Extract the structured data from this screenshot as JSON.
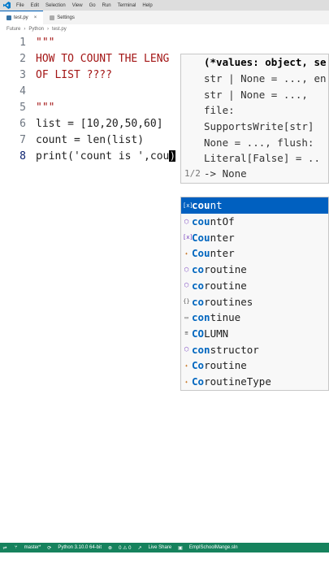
{
  "menubar": {
    "items": [
      "File",
      "Edit",
      "Selection",
      "View",
      "Go",
      "Run",
      "Terminal",
      "Help"
    ]
  },
  "tabs": [
    {
      "label": "test.py",
      "active": true
    },
    {
      "label": "Settings",
      "active": false
    }
  ],
  "breadcrumb": [
    "Future",
    "Python",
    "test.py"
  ],
  "editor": {
    "lines": [
      {
        "number": "1",
        "text": "\"\"\""
      },
      {
        "number": "2",
        "text": "HOW TO COUNT THE LENG"
      },
      {
        "number": "3",
        "text": "OF LIST ????"
      },
      {
        "number": "4",
        "text": ""
      },
      {
        "number": "5",
        "text": "\"\"\""
      },
      {
        "number": "6",
        "text": "list = [10,20,50,60]"
      },
      {
        "number": "7",
        "text": "count = len(list)"
      },
      {
        "number": "8",
        "text": "print('count is ',cou"
      }
    ],
    "bracket_char": ")"
  },
  "signature_help": {
    "lines": [
      "(*values: object, se",
      "str | None = ..., en",
      "str | None = ...,",
      "file:",
      "SupportsWrite[str]",
      "None = ..., flush:",
      "Literal[False] = ..",
      "-> None"
    ],
    "overload_counter": "1/2"
  },
  "suggestions": [
    {
      "label": "count",
      "icon": "variable-icon",
      "match": "cou",
      "rest": "nt"
    },
    {
      "label": "countOf",
      "icon": "function-icon",
      "match": "cou",
      "rest": "ntOf"
    },
    {
      "label": "Counter",
      "icon": "variable-icon",
      "match": "Cou",
      "rest": "nter"
    },
    {
      "label": "Counter",
      "icon": "class-icon",
      "match": "Cou",
      "rest": "nter"
    },
    {
      "label": "coroutine",
      "icon": "function-icon",
      "match": "co",
      "rest": "routine"
    },
    {
      "label": "coroutine",
      "icon": "function-icon",
      "match": "co",
      "rest": "routine"
    },
    {
      "label": "coroutines",
      "icon": "module-icon",
      "match": "co",
      "rest": "routines"
    },
    {
      "label": "continue",
      "icon": "keyword-icon",
      "match": "con",
      "rest": "tinue"
    },
    {
      "label": "COLUMN",
      "icon": "constant-icon",
      "match": "CO",
      "rest": "LUMN"
    },
    {
      "label": "constructor",
      "icon": "function-icon",
      "match": "con",
      "rest": "structor"
    },
    {
      "label": "Coroutine",
      "icon": "class-icon",
      "match": "Co",
      "rest": "routine"
    },
    {
      "label": "CoroutineType",
      "icon": "class-icon",
      "match": "Co",
      "rest": "routineType"
    }
  ],
  "statusbar": {
    "branch": "master*",
    "python": "Python 3.10.0 64-bit",
    "problems": "0 ⚠ 0",
    "live_share": "Live Share",
    "solution": "EmplSchoolMange.sln"
  },
  "colors": {
    "accent": "#0060c0",
    "status_bar": "#16825d",
    "string": "#a31515"
  }
}
